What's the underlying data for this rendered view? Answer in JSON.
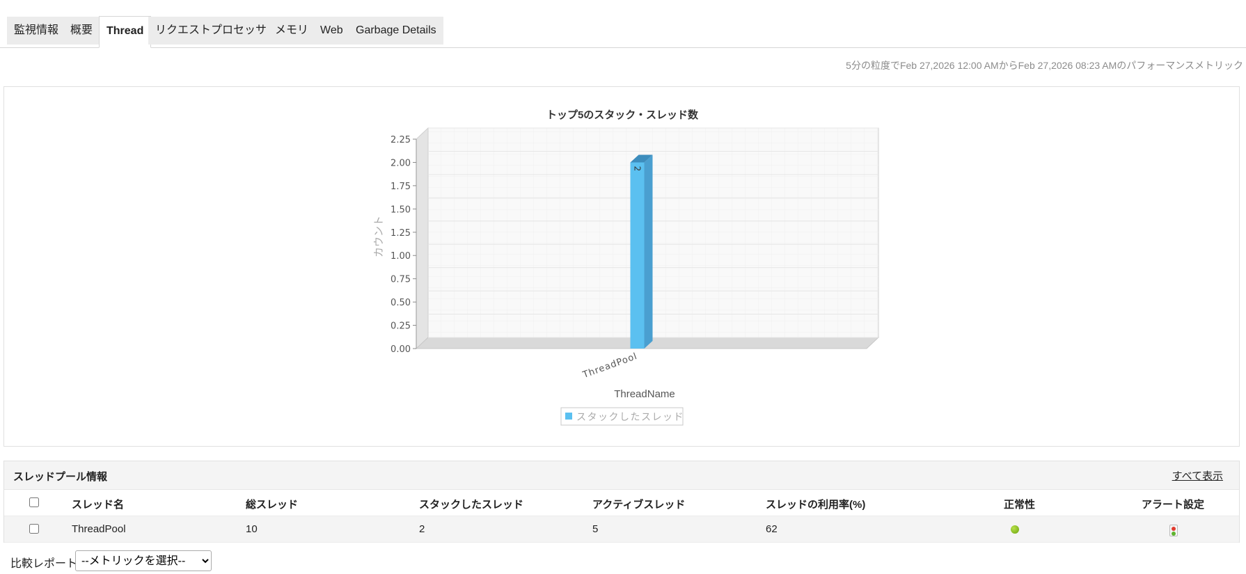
{
  "tabs": [
    {
      "label": "監視情報",
      "active": false
    },
    {
      "label": "概要",
      "active": false
    },
    {
      "label": "Thread",
      "active": true
    },
    {
      "label": "リクエストプロセッサ",
      "active": false
    },
    {
      "label": "メモリ",
      "active": false
    },
    {
      "label": "Web",
      "active": false
    },
    {
      "label": "Garbage Details",
      "active": false
    }
  ],
  "subtitle": "5分の粒度でFeb 27,2026 12:00 AMからFeb 27,2026 08:23 AMのパフォーマンスメトリック",
  "chart_data": {
    "type": "bar",
    "title": "トップ5のスタック・スレッド数",
    "xlabel": "ThreadName",
    "ylabel": "カウント",
    "categories": [
      "ThreadPool"
    ],
    "series": [
      {
        "name": "スタックしたスレッド",
        "values": [
          2
        ],
        "color": "#5bc0f0"
      }
    ],
    "ylim": [
      0,
      2.25
    ],
    "yticks": [
      "0.00",
      "0.25",
      "0.50",
      "0.75",
      "1.00",
      "1.25",
      "1.50",
      "1.75",
      "2.00",
      "2.25"
    ],
    "data_labels": [
      "2"
    ],
    "grid": true,
    "legend": "bottom"
  },
  "table": {
    "title": "スレッドプール情報",
    "show_all": "すべて表示",
    "columns": [
      "スレッド名",
      "総スレッド",
      "スタックしたスレッド",
      "アクティブスレッド",
      "スレッドの利用率(%)",
      "正常性",
      "アラート設定"
    ],
    "rows": [
      {
        "name": "ThreadPool",
        "total": "10",
        "stuck": "2",
        "active": "5",
        "utilization": "62",
        "health": "green"
      }
    ]
  },
  "compare": {
    "label": "比較レポート",
    "selected": "--メトリックを選択--"
  }
}
